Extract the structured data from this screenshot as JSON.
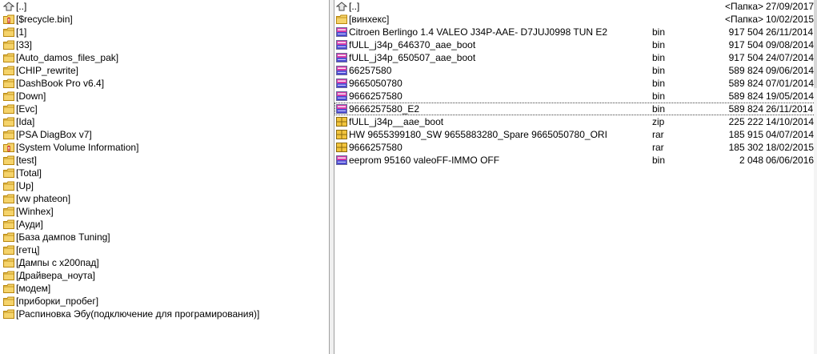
{
  "left_panel": {
    "items": [
      {
        "label": "[..]",
        "icon": "up-arrow-icon"
      },
      {
        "label": "[$recycle.bin]",
        "icon": "system-folder-icon"
      },
      {
        "label": "[1]",
        "icon": "folder-icon"
      },
      {
        "label": "[33]",
        "icon": "folder-icon"
      },
      {
        "label": "[Auto_damos_files_pak]",
        "icon": "folder-icon"
      },
      {
        "label": "[CHIP_rewrite]",
        "icon": "folder-icon"
      },
      {
        "label": "[DashBook Pro v6.4]",
        "icon": "folder-icon"
      },
      {
        "label": "[Down]",
        "icon": "folder-icon"
      },
      {
        "label": "[Evc]",
        "icon": "folder-icon"
      },
      {
        "label": "[Ida]",
        "icon": "folder-icon"
      },
      {
        "label": "[PSA DiagBox v7]",
        "icon": "folder-icon"
      },
      {
        "label": "[System Volume Information]",
        "icon": "system-folder-icon"
      },
      {
        "label": "[test]",
        "icon": "folder-icon"
      },
      {
        "label": "[Total]",
        "icon": "folder-icon"
      },
      {
        "label": "[Up]",
        "icon": "folder-icon"
      },
      {
        "label": "[vw phateon]",
        "icon": "folder-icon"
      },
      {
        "label": "[Winhex]",
        "icon": "folder-icon"
      },
      {
        "label": "[Ауди]",
        "icon": "folder-icon"
      },
      {
        "label": "[База дампов Tuning]",
        "icon": "folder-icon"
      },
      {
        "label": "[гетц]",
        "icon": "folder-icon"
      },
      {
        "label": "[Дампы с х200пад]",
        "icon": "folder-icon"
      },
      {
        "label": "[Драйвера_ноута]",
        "icon": "folder-icon"
      },
      {
        "label": "[модем]",
        "icon": "folder-icon"
      },
      {
        "label": "[приборки_пробег]",
        "icon": "folder-icon"
      },
      {
        "label": "[Распиновка Эбу(подключение для програмирования)]",
        "icon": "folder-icon"
      }
    ]
  },
  "right_panel": {
    "items": [
      {
        "name": "[..]",
        "ext": "",
        "size": "<Папка>",
        "date": "27/09/2017",
        "icon": "up-arrow-icon"
      },
      {
        "name": "[винхекс]",
        "ext": "",
        "size": "<Папка>",
        "date": "10/02/2015",
        "icon": "folder-icon"
      },
      {
        "name": "Citroen Berlingo  1.4 VALEO J34P-AAE-  D7JUJ0998 TUN E2",
        "ext": "bin",
        "size": "917 504",
        "date": "26/11/2014",
        "icon": "hex-file-icon"
      },
      {
        "name": "fULL_j34p_646370_aae_boot",
        "ext": "bin",
        "size": "917 504",
        "date": "09/08/2014",
        "icon": "hex-file-icon"
      },
      {
        "name": "fULL_j34p_650507_aae_boot",
        "ext": "bin",
        "size": "917 504",
        "date": "24/07/2014",
        "icon": "hex-file-icon"
      },
      {
        "name": "66257580",
        "ext": "bin",
        "size": "589 824",
        "date": "09/06/2014",
        "icon": "hex-file-icon"
      },
      {
        "name": "9665050780",
        "ext": "bin",
        "size": "589 824",
        "date": "07/01/2014",
        "icon": "hex-file-icon"
      },
      {
        "name": "9666257580",
        "ext": "bin",
        "size": "589 824",
        "date": "19/05/2014",
        "icon": "hex-file-icon"
      },
      {
        "name": "9666257580_E2",
        "ext": "bin",
        "size": "589 824",
        "date": "26/11/2014",
        "icon": "hex-file-icon",
        "cursor": true
      },
      {
        "name": "fULL_j34p__aae_boot",
        "ext": "zip",
        "size": "225 222",
        "date": "14/10/2014",
        "icon": "archive-icon"
      },
      {
        "name": "HW 9655399180_SW 9655883280_Spare 9665050780_ORI",
        "ext": "rar",
        "size": "185 915",
        "date": "04/07/2014",
        "icon": "archive-icon"
      },
      {
        "name": "9666257580",
        "ext": "rar",
        "size": "185 302",
        "date": "18/02/2015",
        "icon": "archive-icon"
      },
      {
        "name": "eeprom 95160 valeoFF-IMMO OFF",
        "ext": "bin",
        "size": "2 048",
        "date": "06/06/2016",
        "icon": "hex-file-icon"
      }
    ]
  },
  "colors": {
    "folder_fill": "#f5d36b",
    "folder_stroke": "#b8860b",
    "hex_icon_pink": "#d63aa8",
    "hex_icon_blue": "#4a4ad0",
    "archive_yellow": "#f2c43c"
  }
}
